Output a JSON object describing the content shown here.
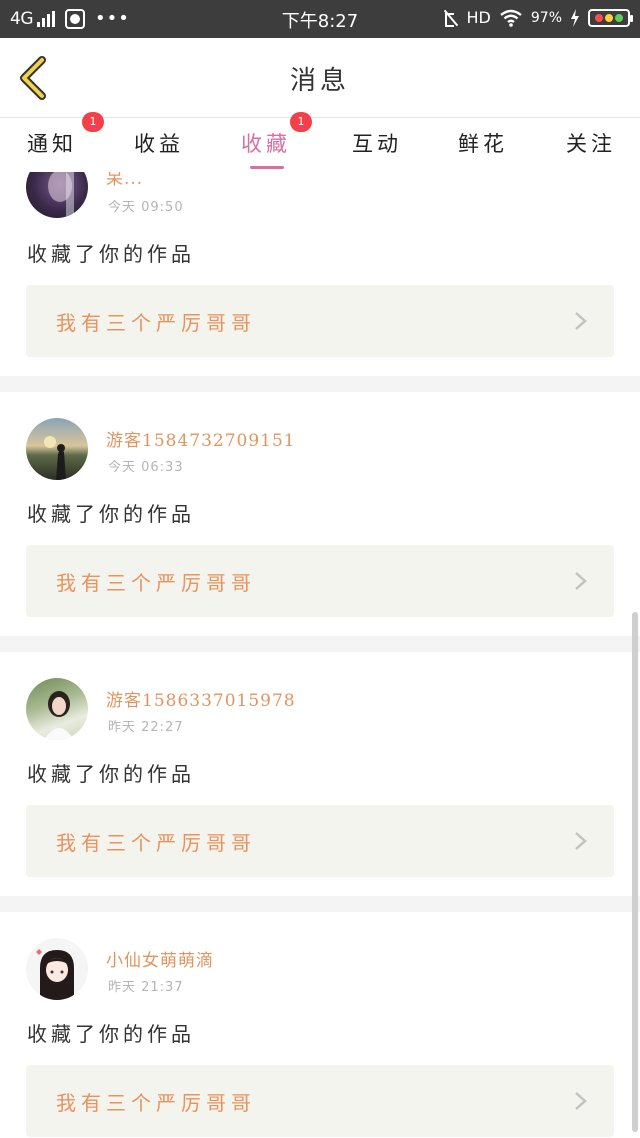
{
  "status_bar": {
    "network": "4G",
    "time": "下午8:27",
    "hd": "HD",
    "battery": "97%"
  },
  "header": {
    "title": "消息",
    "back_icon": "chevron-left-icon"
  },
  "tabs": [
    {
      "label": "通知",
      "badge": "1",
      "active": false
    },
    {
      "label": "收益",
      "badge": "",
      "active": false
    },
    {
      "label": "收藏",
      "badge": "1",
      "active": true
    },
    {
      "label": "互动",
      "badge": "",
      "active": false
    },
    {
      "label": "鲜花",
      "badge": "",
      "active": false
    },
    {
      "label": "关注",
      "badge": "",
      "active": false
    }
  ],
  "colors": {
    "accent": "#d96fa0",
    "badge": "#f23f4a",
    "username": "#e09560",
    "work_title": "#e8925d",
    "work_bg": "#f4f4ee"
  },
  "messages": [
    {
      "username": "呆...",
      "time": "今天 09:50",
      "action": "收藏了你的作品",
      "work_title": "我有三个严厉哥哥"
    },
    {
      "username": "游客1584732709151",
      "time": "今天 06:33",
      "action": "收藏了你的作品",
      "work_title": "我有三个严厉哥哥"
    },
    {
      "username": "游客1586337015978",
      "time": "昨天 22:27",
      "action": "收藏了你的作品",
      "work_title": "我有三个严厉哥哥"
    },
    {
      "username": "小仙女萌萌滴",
      "time": "昨天 21:37",
      "action": "收藏了你的作品",
      "work_title": "我有三个严厉哥哥"
    }
  ]
}
